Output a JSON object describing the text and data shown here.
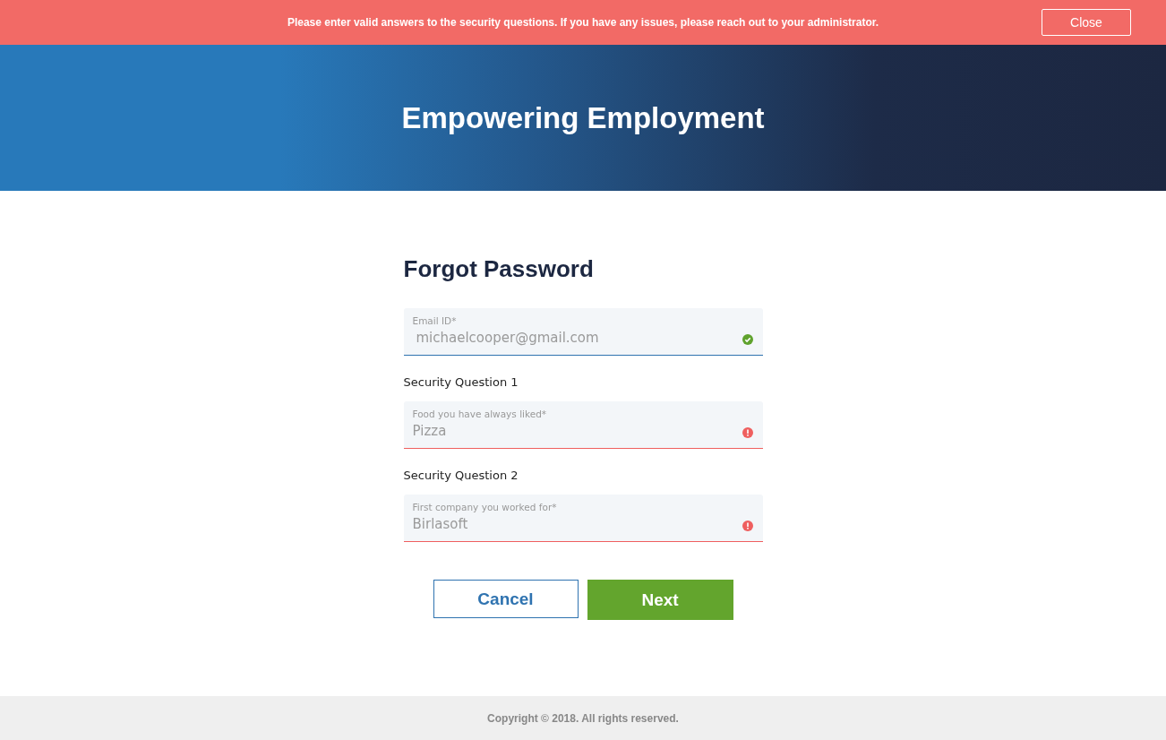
{
  "alert": {
    "message": "Please enter valid answers to the security questions. If you have any issues, please reach out to your administrator.",
    "close": "Close"
  },
  "hero": {
    "title": "Empowering Employment"
  },
  "form": {
    "title": "Forgot Password",
    "fields": [
      {
        "label": "Email ID*",
        "value": "michaelcooper@gmail.com",
        "valid": true
      },
      {
        "section": "Security Question 1",
        "label": "Food you have always liked*",
        "value": "Pizza",
        "valid": false
      },
      {
        "section": "Security Question 2",
        "label": "First company you worked for*",
        "value": "Birlasoft",
        "valid": false
      }
    ],
    "cancel": "Cancel",
    "next": "Next"
  },
  "footer": {
    "text": "Copyright © 2018. All rights reserved."
  }
}
